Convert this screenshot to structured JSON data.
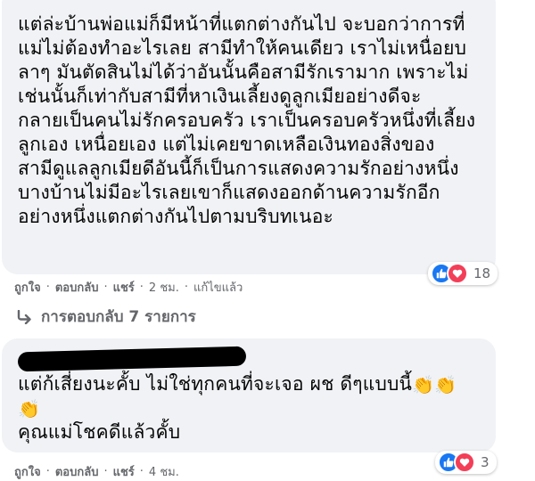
{
  "comment1": {
    "lines": [
      "แต่ล่ะบ้านพ่อแม่ก็มีหน้าที่แตกต่างกันไป จะบอกว่าการที่",
      "แม่ไม่ต้องทำอะไรเลย สามีทำให้คนเดียว เราไม่เหนื่อยบ",
      "ลาๆ มันตัดสินไม่ได้ว่าอันนั้นคือสามีรักเรามาก เพราะไม่",
      "เช่นนั้นก็เท่ากับสามีที่หาเงินเลี้ยงดูลูกเมียอย่างดีจะ",
      "กลายเป็นคนไม่รักครอบครัว เราเป็นครอบครัวหนึ่งที่เลี้ยง",
      "ลูกเอง เหนื่อยเอง แต่ไม่เคยขาดเหลือเงินทองสิ่งของ",
      "สามีดูแลลูกเมียดีอันนี้ก็เป็นการแสดงความรักอย่างหนึ่ง",
      "บางบ้านไม่มีอะไรเลยเขาก็แสดงออกด้านความรักอีก",
      "อย่างหนึ่งแตกต่างกันไปตามบริบทเนอะ"
    ],
    "reaction_count": "18",
    "like_label": "ถูกใจ",
    "reply_label": "ตอบกลับ",
    "share_label": "แชร์",
    "time_label": "2 ชม.",
    "edited_label": "แก้ไขแล้ว"
  },
  "replies_toggle": {
    "label": "การตอบกลับ 7 รายการ"
  },
  "comment2": {
    "line1": "แต่ก้เสี่ยงนะคั้บ ไม่ใช่ทุกคนที่จะเจอ ผช ดีๆแบบนี้",
    "line3": "คุณแม่โชคดีแล้วคั้บ",
    "reaction_count": "3",
    "like_label": "ถูกใจ",
    "reply_label": "ตอบกลับ",
    "share_label": "แชร์",
    "time_label": "4 ชม."
  },
  "colors": {
    "bubble": "#f0f2f5",
    "meta_text": "#65676b",
    "like_blue": "#1877f2",
    "love_red": "#f33e58"
  },
  "icons": [
    "reply-arrow-icon",
    "like-reaction-icon",
    "love-reaction-icon",
    "clapping-hands-icon"
  ]
}
